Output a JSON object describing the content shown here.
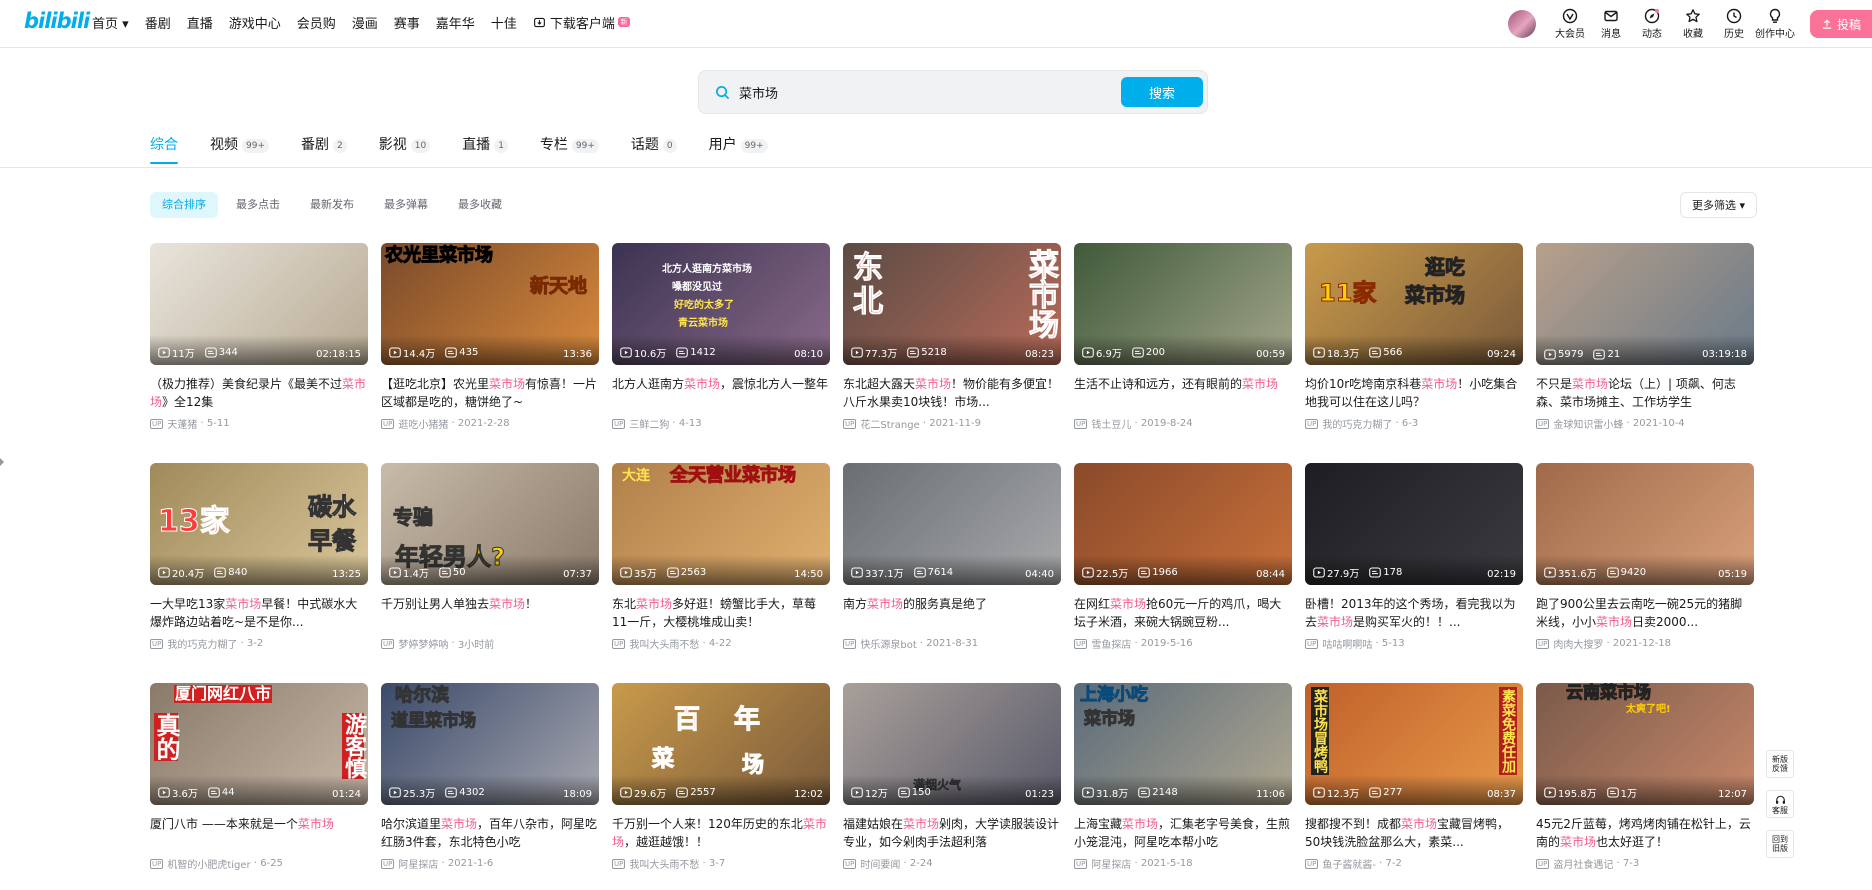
{
  "logo": "bilibili",
  "nav": {
    "items": [
      "首页",
      "番剧",
      "直播",
      "游戏中心",
      "会员购",
      "漫画",
      "赛事",
      "嘉年华"
    ],
    "tv": "十佳",
    "download": "下载客户端",
    "new_badge": "新"
  },
  "right_nav": {
    "items": [
      "大会员",
      "消息",
      "动态",
      "收藏",
      "历史",
      "创作中心"
    ],
    "upload": "投稿"
  },
  "search": {
    "query": "菜市场",
    "button": "搜索"
  },
  "tabs": [
    {
      "label": "综合",
      "count": ""
    },
    {
      "label": "视频",
      "count": "99+"
    },
    {
      "label": "番剧",
      "count": "2"
    },
    {
      "label": "影视",
      "count": "10"
    },
    {
      "label": "直播",
      "count": "1"
    },
    {
      "label": "专栏",
      "count": "99+"
    },
    {
      "label": "话题",
      "count": "0"
    },
    {
      "label": "用户",
      "count": "99+"
    }
  ],
  "sorts": [
    "综合排序",
    "最多点击",
    "最新发布",
    "最多弹幕",
    "最多收藏"
  ],
  "more_filter": "更多筛选",
  "videos": [
    {
      "pre": "（极力推荐）美食纪录片《最美不过",
      "kw": "菜市场",
      "post": "》全12集",
      "views": "11万",
      "danmaku": "344",
      "duration": "02:18:15",
      "author": "天蓬猪",
      "date": "5-11",
      "bg": [
        "#e9e4dc",
        "#b7aa92"
      ],
      "ov": []
    },
    {
      "pre": "【逛吃北京】农光里",
      "kw": "菜市场",
      "post": "有惊喜！一片区域都是吃的，糖饼绝了~",
      "views": "14.4万",
      "danmaku": "435",
      "duration": "13:36",
      "author": "逛吃小猪猪",
      "date": "2021-2-28",
      "bg": [
        "#7a4a2a",
        "#d98a3d"
      ],
      "ov": [
        "农光里菜市场",
        "新天地"
      ]
    },
    {
      "pre": "北方人逛南方",
      "kw": "菜市场",
      "post": "，震惊北方人一整年",
      "views": "10.6万",
      "danmaku": "1412",
      "duration": "08:10",
      "author": "三鲜二狗",
      "date": "4-13",
      "bg": [
        "#3b3350",
        "#8a6a8a"
      ],
      "ov": [
        "北方人逛南方菜市场",
        "嗓都没见过",
        "好吃的太多了",
        "青云菜市场"
      ]
    },
    {
      "pre": "东北超大露天",
      "kw": "菜市场",
      "post": "！物价能有多便宜！八斤水果卖10块钱！市场...",
      "views": "77.3万",
      "danmaku": "5218",
      "duration": "08:23",
      "author": "花二Strange",
      "date": "2021-11-9",
      "bg": [
        "#5a4b44",
        "#b96b5a"
      ],
      "ov": [
        "东北",
        "菜市场"
      ]
    },
    {
      "pre": "生活不止诗和远方，还有眼前的",
      "kw": "菜市场",
      "post": "",
      "views": "6.9万",
      "danmaku": "200",
      "duration": "00:59",
      "author": "钱土豆儿",
      "date": "2019-8-24",
      "bg": [
        "#3f5a3a",
        "#a3a58a"
      ],
      "ov": []
    },
    {
      "pre": "均价10r吃垮南京科巷",
      "kw": "菜市场",
      "post": "！小吃集合地我可以住在这儿吗？",
      "views": "18.3万",
      "danmaku": "566",
      "duration": "09:24",
      "author": "我的巧克力糊了",
      "date": "6-3",
      "bg": [
        "#c99a4a",
        "#7a5a3a"
      ],
      "ov": [
        "11家",
        "逛吃",
        "菜市场"
      ]
    },
    {
      "pre": "不只是",
      "kw": "菜市场",
      "post": "论坛（上）| 项飙、何志森、菜市场摊主、工作坊学生",
      "views": "5979",
      "danmaku": "21",
      "duration": "03:19:18",
      "author": "金球知识雷小蜂",
      "date": "2021-10-4",
      "bg": [
        "#b8a08a",
        "#6a7a8a"
      ],
      "ov": []
    },
    {
      "pre": "一大早吃13家",
      "kw": "菜市场",
      "post": "早餐！中式碳水大爆炸路边站着吃~是不是你...",
      "views": "20.4万",
      "danmaku": "840",
      "duration": "13:25",
      "author": "我的巧克力糊了",
      "date": "3-2",
      "bg": [
        "#a08a5a",
        "#d9c69a"
      ],
      "ov": [
        "13家",
        "碳水",
        "早餐"
      ]
    },
    {
      "pre": "千万别让男人单独去",
      "kw": "菜市场",
      "post": "！",
      "views": "1.4万",
      "danmaku": "50",
      "duration": "07:37",
      "author": "梦婷梦婷呐",
      "date": "3小时前",
      "bg": [
        "#c8bba8",
        "#8a7a6a"
      ],
      "ov": [
        "专骗",
        "年轻男人?"
      ]
    },
    {
      "pre": "东北",
      "kw": "菜市场",
      "post": "多好逛！螃蟹比手大，草莓11一斤，大樱桃堆成山卖！",
      "views": "35万",
      "danmaku": "2563",
      "duration": "14:50",
      "author": "我叫大头雨不愁",
      "date": "4-22",
      "bg": [
        "#b0804a",
        "#e0b070"
      ],
      "ov": [
        "大连",
        "全天营业菜市场"
      ]
    },
    {
      "pre": "南方",
      "kw": "菜市场",
      "post": "的服务真是绝了",
      "views": "337.1万",
      "danmaku": "7614",
      "duration": "04:40",
      "author": "快乐源泉bot",
      "date": "2021-8-31",
      "bg": [
        "#6a6e72",
        "#a7a9ab"
      ],
      "ov": []
    },
    {
      "pre": "在网红",
      "kw": "菜市场",
      "post": "抢60元一斤的鸡爪，喝大坛子米酒，来碗大锅豌豆粉...",
      "views": "22.5万",
      "danmaku": "1966",
      "duration": "08:44",
      "author": "雪鱼探店",
      "date": "2019-5-16",
      "bg": [
        "#8a4a2a",
        "#c8703a"
      ],
      "ov": []
    },
    {
      "pre": "卧槽！2013年的这个秀场，看完我以为去",
      "kw": "菜市场",
      "post": "是购买军火的！！...",
      "views": "27.9万",
      "danmaku": "178",
      "duration": "02:19",
      "author": "咕咕啊啊咕",
      "date": "5-13",
      "bg": [
        "#1e1e22",
        "#3a3a40"
      ],
      "ov": []
    },
    {
      "pre": "跑了900公里去云南吃一碗25元的猪脚米线，小小",
      "kw": "菜市场",
      "post": "日卖2000...",
      "views": "351.6万",
      "danmaku": "9420",
      "duration": "05:19",
      "author": "肉肉大搜罗",
      "date": "2021-12-18",
      "bg": [
        "#a06a4a",
        "#d8a07a"
      ],
      "ov": []
    },
    {
      "pre": "厦门八市 ——本来就是一个",
      "kw": "菜市场",
      "post": "",
      "views": "3.6万",
      "danmaku": "44",
      "duration": "01:24",
      "author": "机智的小肥虎tiger",
      "date": "6-25",
      "bg": [
        "#8a7a6a",
        "#c8b8a8"
      ],
      "ov": [
        "厦门网红八市",
        "真的",
        "游客慎"
      ]
    },
    {
      "pre": "哈尔滨道里",
      "kw": "菜市场",
      "post": "，百年八杂市，阿星吃红肠3件套，东北特色小吃",
      "views": "25.3万",
      "danmaku": "4302",
      "duration": "18:09",
      "author": "阿星探店",
      "date": "2021-1-6",
      "bg": [
        "#3a4a6a",
        "#a8a8b0"
      ],
      "ov": [
        "哈尔滨",
        "道里菜市场"
      ]
    },
    {
      "pre": "千万别一个人来！120年历史的东北",
      "kw": "菜市场",
      "post": "，越逛越饿！！",
      "views": "29.6万",
      "danmaku": "2557",
      "duration": "12:02",
      "author": "我叫大头雨不愁",
      "date": "3-7",
      "bg": [
        "#c89a4a",
        "#7a5a3a"
      ],
      "ov": [
        "百年",
        "菜",
        "场"
      ]
    },
    {
      "pre": "福建姑娘在",
      "kw": "菜市场",
      "post": "剁肉，大学读服装设计专业，如今剁肉手法超利落",
      "views": "12万",
      "danmaku": "150",
      "duration": "01:23",
      "author": "时间要闻",
      "date": "2-24",
      "bg": [
        "#a8a09a",
        "#5a5a6a"
      ],
      "ov": [
        "满烟火气"
      ]
    },
    {
      "pre": "上海宝藏",
      "kw": "菜市场",
      "post": "，汇集老字号美食，生煎小笼混沌，阿星吃本帮小吃",
      "views": "31.8万",
      "danmaku": "2148",
      "duration": "11:06",
      "author": "阿星探店",
      "date": "2021-5-18",
      "bg": [
        "#5a6a7a",
        "#b0a890"
      ],
      "ov": [
        "上海小吃",
        "菜市场"
      ]
    },
    {
      "pre": "搜都搜不到！成都",
      "kw": "菜市场",
      "post": "宝藏冒烤鸭，50块钱洗脸盆那么大，素菜...",
      "views": "12.3万",
      "danmaku": "277",
      "duration": "08:37",
      "author": "鱼子酱就酱-",
      "date": "7-2",
      "bg": [
        "#c0602a",
        "#e89a4a"
      ],
      "ov": [
        "菜市场冒烤鸭",
        "素菜免费任加"
      ]
    },
    {
      "pre": "45元2斤蓝莓，烤鸡烤肉铺在松针上，云南的",
      "kw": "菜市场",
      "post": "也太好逛了！",
      "views": "195.8万",
      "danmaku": "1万",
      "duration": "12:07",
      "author": "盗月社食遇记",
      "date": "7-3",
      "bg": [
        "#7a5a4a",
        "#c8886a"
      ],
      "ov": [
        "云南菜市场",
        "太爽了吧!"
      ]
    }
  ],
  "fixed_btns": [
    [
      "新版",
      "反馈"
    ],
    [
      "客服"
    ],
    [
      "回到",
      "旧版"
    ]
  ]
}
